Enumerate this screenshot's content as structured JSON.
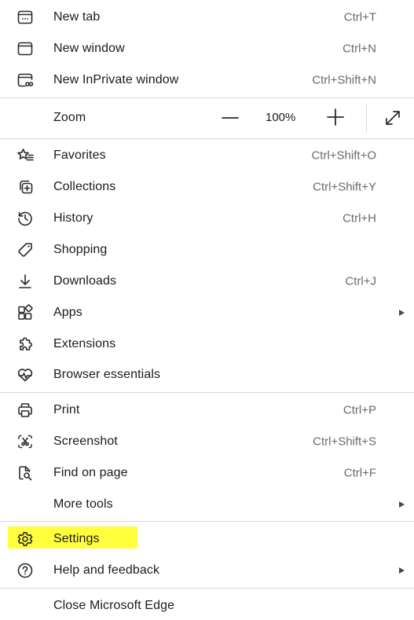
{
  "menu": {
    "items": [
      {
        "label": "New tab",
        "shortcut": "Ctrl+T"
      },
      {
        "label": "New window",
        "shortcut": "Ctrl+N"
      },
      {
        "label": "New InPrivate window",
        "shortcut": "Ctrl+Shift+N"
      },
      {
        "label": "Favorites",
        "shortcut": "Ctrl+Shift+O"
      },
      {
        "label": "Collections",
        "shortcut": "Ctrl+Shift+Y"
      },
      {
        "label": "History",
        "shortcut": "Ctrl+H"
      },
      {
        "label": "Shopping"
      },
      {
        "label": "Downloads",
        "shortcut": "Ctrl+J"
      },
      {
        "label": "Apps"
      },
      {
        "label": "Extensions"
      },
      {
        "label": "Browser essentials"
      },
      {
        "label": "Print",
        "shortcut": "Ctrl+P"
      },
      {
        "label": "Screenshot",
        "shortcut": "Ctrl+Shift+S"
      },
      {
        "label": "Find on page",
        "shortcut": "Ctrl+F"
      },
      {
        "label": "More tools"
      },
      {
        "label": "Settings"
      },
      {
        "label": "Help and feedback"
      },
      {
        "label": "Close Microsoft Edge"
      }
    ],
    "zoom": {
      "label": "Zoom",
      "value": "100%"
    }
  },
  "colors": {
    "highlight": "#ffff3d",
    "divider": "#d9d9d9",
    "text": "#1b1b1b",
    "shortcut": "#6a6a6a"
  },
  "icons": [
    "new-tab-icon",
    "new-window-icon",
    "inprivate-icon",
    "favorites-icon",
    "collections-icon",
    "history-icon",
    "shopping-icon",
    "downloads-icon",
    "apps-icon",
    "extensions-icon",
    "browser-essentials-icon",
    "print-icon",
    "screenshot-icon",
    "find-on-page-icon",
    "settings-icon",
    "help-icon",
    "fullscreen-icon",
    "zoom-in-icon",
    "zoom-out-icon",
    "submenu-arrow-icon"
  ]
}
